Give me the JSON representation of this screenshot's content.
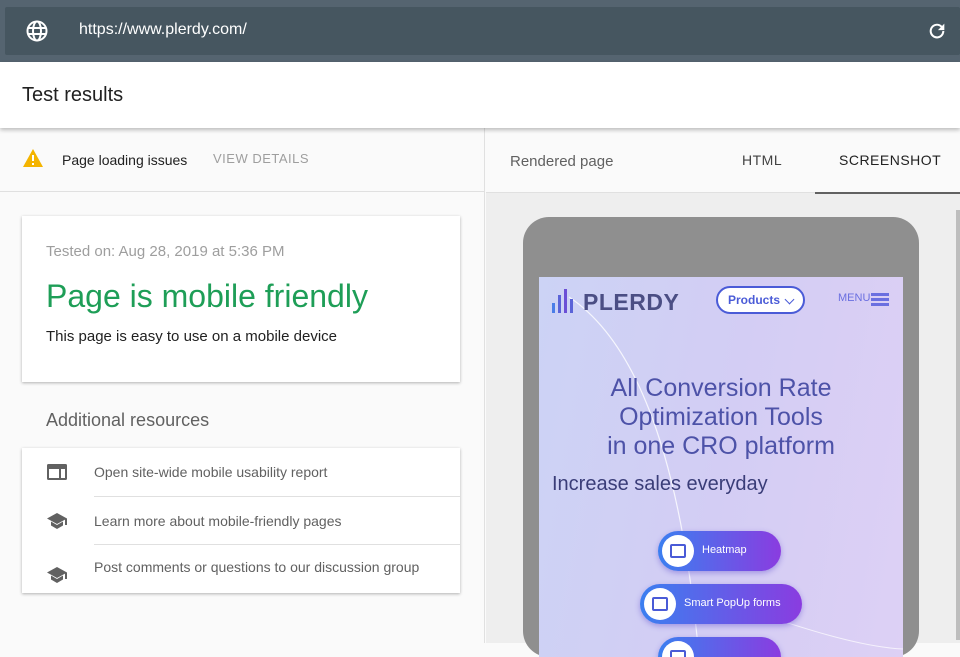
{
  "browser": {
    "url": "https://www.plerdy.com/"
  },
  "header": {
    "title": "Test results"
  },
  "issues": {
    "text": "Page loading issues",
    "action": "VIEW DETAILS"
  },
  "result": {
    "tested_on": "Tested on: Aug 28, 2019 at 5:36 PM",
    "headline": "Page is mobile friendly",
    "subtext": "This page is easy to use on a mobile device",
    "headline_color": "#1e9e57"
  },
  "resources": {
    "title": "Additional resources",
    "items": [
      {
        "label": "Open site-wide mobile usability report",
        "icon": "web-page-icon"
      },
      {
        "label": "Learn more about mobile-friendly pages",
        "icon": "school-icon"
      },
      {
        "label": "Post comments or questions to our discussion group",
        "icon": "school-icon"
      }
    ]
  },
  "tabs": {
    "rendered": "Rendered page",
    "html": "HTML",
    "screenshot": "SCREENSHOT",
    "active": "SCREENSHOT"
  },
  "site": {
    "logo": "PLERDY",
    "products": "Products",
    "menu": "MENU",
    "hero": [
      "All Conversion Rate",
      "Optimization Tools",
      "in one CRO platform"
    ],
    "subhero": "Increase sales everyday",
    "buttons": [
      "Heatmap",
      "Smart PopUp forms"
    ]
  }
}
